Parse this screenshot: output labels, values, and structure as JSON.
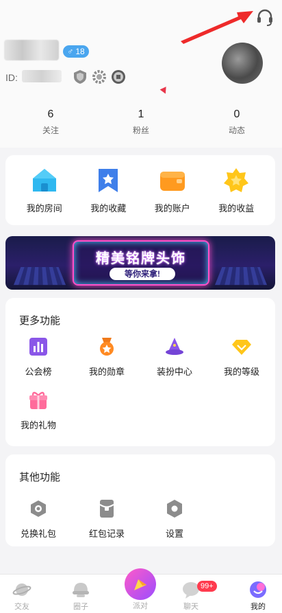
{
  "profile": {
    "gender_symbol": "♂",
    "level": "18",
    "id_label": "ID:"
  },
  "stats": [
    {
      "value": "6",
      "label": "关注"
    },
    {
      "value": "1",
      "label": "粉丝"
    },
    {
      "value": "0",
      "label": "动态"
    }
  ],
  "quick_actions": [
    {
      "label": "我的房间",
      "icon": "house-icon"
    },
    {
      "label": "我的收藏",
      "icon": "bookmark-star-icon"
    },
    {
      "label": "我的账户",
      "icon": "wallet-icon"
    },
    {
      "label": "我的收益",
      "icon": "star-badge-icon"
    }
  ],
  "banner": {
    "title": "精美铭牌头饰",
    "subtitle": "等你来拿!"
  },
  "more_functions": {
    "title": "更多功能",
    "items": [
      {
        "label": "公会榜",
        "icon": "chart-icon"
      },
      {
        "label": "我的勋章",
        "icon": "medal-icon"
      },
      {
        "label": "装扮中心",
        "icon": "wizard-hat-icon"
      },
      {
        "label": "我的等级",
        "icon": "diamond-icon"
      },
      {
        "label": "我的礼物",
        "icon": "gift-icon"
      }
    ]
  },
  "other_functions": {
    "title": "其他功能",
    "items": [
      {
        "label": "兑换礼包",
        "icon": "exchange-icon"
      },
      {
        "label": "红包记录",
        "icon": "red-packet-icon"
      },
      {
        "label": "设置",
        "icon": "settings-icon"
      }
    ]
  },
  "tabs": [
    {
      "label": "交友",
      "icon": "planet-icon"
    },
    {
      "label": "圈子",
      "icon": "circle-icon"
    },
    {
      "label": "派对",
      "icon": "party-icon"
    },
    {
      "label": "聊天",
      "icon": "chat-icon",
      "badge": "99+"
    },
    {
      "label": "我的",
      "icon": "me-icon",
      "active": true
    }
  ],
  "colors": {
    "accent_blue": "#4aa6ef",
    "party_gradient_start": "#ff5ac8",
    "party_gradient_end": "#9b4dff",
    "badge_red": "#ff3b4e"
  }
}
